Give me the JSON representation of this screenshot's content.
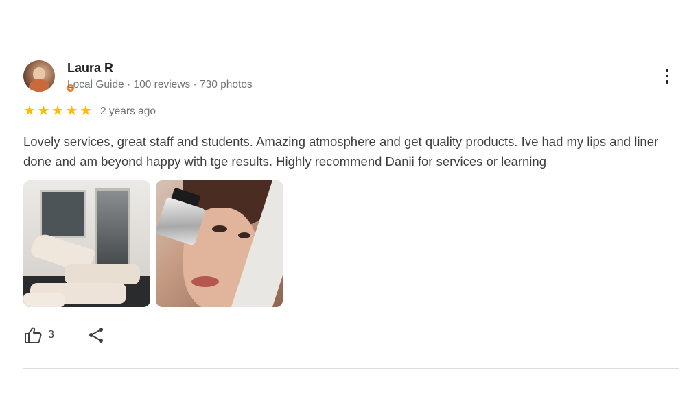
{
  "review": {
    "author": "Laura R",
    "meta": "Local Guide · 100 reviews · 730 photos",
    "rating": 5,
    "stars": [
      "★",
      "★",
      "★",
      "★",
      "★"
    ],
    "time": "2 years ago",
    "text": "Lovely services, great staff and students. Amazing atmosphere and get quality products. Ive had my lips and liner done and am beyond happy with tge results. Highly recommend Danii for services or learning",
    "photos": [
      "clinic-room-photo",
      "product-poster-photo"
    ],
    "likes": "3"
  },
  "icons": {
    "more": "more-vert-icon",
    "like": "thumb-up-icon",
    "share": "share-icon",
    "guide": "local-guide-badge-icon"
  },
  "colors": {
    "star": "#fbbc04",
    "badge": "#f07c33",
    "secondary_text": "#70757a"
  }
}
